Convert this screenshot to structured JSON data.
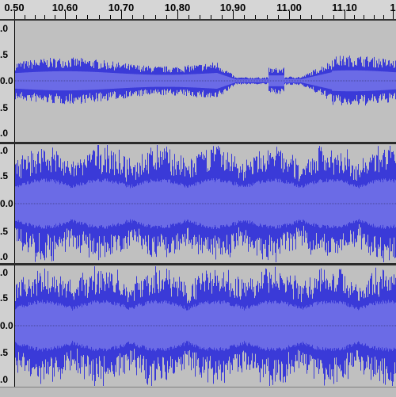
{
  "ruler": {
    "labels": [
      "0.50",
      "10.60",
      "10.70",
      "10.80",
      "10.90",
      "11.00",
      "11.10",
      "1"
    ]
  },
  "tracks": [
    {
      "scale_labels": [
        ".0",
        ".5",
        "0.0",
        ".5",
        ".0"
      ],
      "waveform": {
        "color": "#4343d0",
        "style": "mono-upper"
      }
    },
    {
      "scale_labels": [
        ".0",
        ".5",
        "0.0",
        ".5",
        ".0"
      ],
      "waveform": {
        "color": "#4343d0",
        "style": "stereo-left"
      }
    },
    {
      "scale_labels": [
        ".0",
        ".5",
        "0.0",
        ".5",
        ".0"
      ],
      "waveform": {
        "color": "#4343d0",
        "style": "stereo-right"
      }
    }
  ],
  "colors": {
    "track_background": "#c0c0c0",
    "waveform_peak": "#3a3ad8",
    "waveform_rms": "#6b6be6",
    "ruler_background": "#d6d6d6"
  }
}
